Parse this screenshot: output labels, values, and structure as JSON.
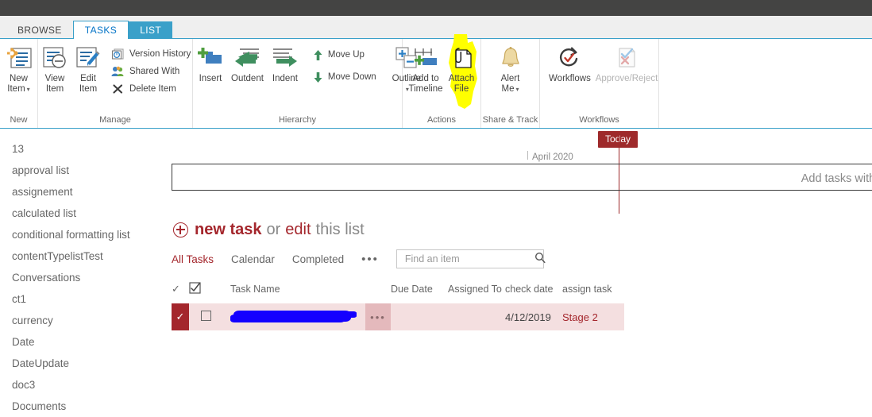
{
  "suite": {},
  "ribbon": {
    "tabs": [
      {
        "label": "BROWSE",
        "state": "browse"
      },
      {
        "label": "TASKS",
        "state": "selected"
      },
      {
        "label": "LIST",
        "state": "unselected"
      }
    ],
    "groups": [
      {
        "name": "New",
        "label": "New",
        "buttons": [
          {
            "label_line1": "New",
            "label_line2": "Item",
            "icon": "new-item-icon",
            "has_caret": true,
            "disabled": false
          }
        ]
      },
      {
        "name": "Manage",
        "label": "Manage",
        "buttons": [
          {
            "label_line1": "View",
            "label_line2": "Item",
            "icon": "view-item-icon",
            "disabled": false
          },
          {
            "label_line1": "Edit",
            "label_line2": "Item",
            "icon": "edit-item-icon",
            "disabled": false
          },
          {
            "label_line1": "Version History",
            "icon": "version-history-icon",
            "disabled": false
          },
          {
            "label_line1": "Shared With",
            "icon": "shared-with-icon",
            "disabled": false
          },
          {
            "label_line1": "Delete Item",
            "icon": "delete-item-icon",
            "disabled": false
          }
        ]
      },
      {
        "name": "Hierarchy",
        "label": "Hierarchy",
        "buttons": [
          {
            "label_line1": "Insert",
            "icon": "insert-row-icon",
            "disabled": false
          },
          {
            "label_line1": "Outdent",
            "icon": "outdent-arrow-icon",
            "disabled": false
          },
          {
            "label_line1": "Indent",
            "icon": "indent-arrow-icon",
            "disabled": false
          },
          {
            "label_line1": "Move Up",
            "icon": "arrow-up-icon",
            "disabled": false
          },
          {
            "label_line1": "Move Down",
            "icon": "arrow-down-icon",
            "disabled": false
          },
          {
            "label_line1": "Outline",
            "icon": "outline-icon",
            "has_caret": true,
            "disabled": false
          }
        ]
      },
      {
        "name": "Actions",
        "label": "Actions",
        "buttons": [
          {
            "label_line1": "Add to",
            "label_line2": "Timeline",
            "icon": "add-to-timeline-icon",
            "disabled": false
          },
          {
            "label_line1": "Attach",
            "label_line2": "File",
            "icon": "attach-file-icon",
            "disabled": false,
            "highlighted": true
          }
        ]
      },
      {
        "name": "Share & Track",
        "label": "Share & Track",
        "buttons": [
          {
            "label_line1": "Alert",
            "label_line2": "Me",
            "icon": "alert-bell-icon",
            "has_caret": true,
            "disabled": false
          }
        ]
      },
      {
        "name": "Workflows",
        "label": "Workflows",
        "buttons": [
          {
            "label_line1": "Workflows",
            "icon": "workflows-icon",
            "disabled": false
          },
          {
            "label_line1": "Approve/Reject",
            "icon": "approve-reject-icon",
            "disabled": true
          }
        ]
      }
    ]
  },
  "sidebar": {
    "items": [
      {
        "label": "13"
      },
      {
        "label": "approval list"
      },
      {
        "label": "assignement"
      },
      {
        "label": "calculated list"
      },
      {
        "label": "conditional formatting list"
      },
      {
        "label": "contentTypelistTest"
      },
      {
        "label": "Conversations"
      },
      {
        "label": "ct1"
      },
      {
        "label": "currency"
      },
      {
        "label": "Date"
      },
      {
        "label": "DateUpdate"
      },
      {
        "label": "doc3"
      },
      {
        "label": "Documents"
      }
    ]
  },
  "timeline": {
    "today_label": "Today",
    "month_label": "April 2020",
    "empty_text": "Add tasks with dates to the"
  },
  "commands": {
    "new_task": "new task",
    "or": "or",
    "edit_link": "edit",
    "edit_tail": "this list"
  },
  "views": {
    "tabs": [
      {
        "label": "All Tasks",
        "selected": true
      },
      {
        "label": "Calendar",
        "selected": false
      },
      {
        "label": "Completed",
        "selected": false
      }
    ],
    "more_label": "•••"
  },
  "search": {
    "placeholder": "Find an item",
    "value": "",
    "icon": "search-icon"
  },
  "table": {
    "columns": [
      {
        "label": "",
        "key": "check"
      },
      {
        "label": "",
        "key": "checkbox"
      },
      {
        "label": "Task Name",
        "key": "task_name"
      },
      {
        "label": "",
        "key": "ellipsis"
      },
      {
        "label": "Due Date",
        "key": "due_date"
      },
      {
        "label": "Assigned To",
        "key": "assigned_to"
      },
      {
        "label": "check date",
        "key": "check_date"
      },
      {
        "label": "assign task",
        "key": "assign_task"
      }
    ],
    "rows": [
      {
        "selected": true,
        "completed_mark": "✓",
        "task_name": "",
        "task_name_redacted": true,
        "ellipsis": "•••",
        "due_date": "",
        "assigned_to": "",
        "check_date": "4/12/2019",
        "assign_task": "Stage 2"
      }
    ]
  },
  "colors": {
    "suite_bar": "#444443",
    "accent_blue": "#3aa0c9",
    "sharepoint_red": "#a4262c",
    "today_marker": "#9e2a2b",
    "row_selected_bg": "#f4dfe0",
    "highlight_yellow": "#ffff00",
    "redaction_blue": "#1400ff"
  }
}
